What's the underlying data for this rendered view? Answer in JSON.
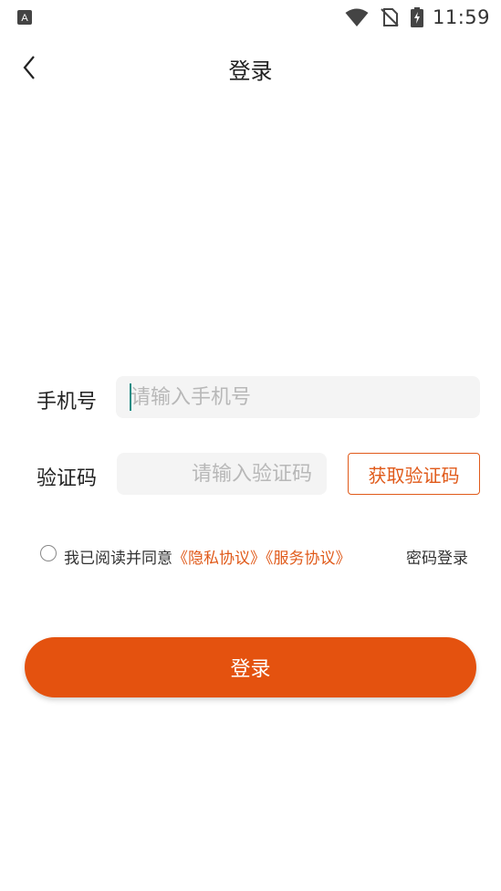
{
  "status_bar": {
    "time": "11:59",
    "left_icon": "a-badge-icon",
    "icons": [
      "wifi-icon",
      "no-sim-icon",
      "battery-charging-icon"
    ]
  },
  "header": {
    "title": "登录",
    "back_icon": "chevron-left-icon"
  },
  "form": {
    "phone": {
      "label": "手机号",
      "placeholder": "请输入手机号",
      "value": ""
    },
    "code": {
      "label": "验证码",
      "placeholder": "请输入验证码",
      "value": ""
    },
    "get_code_label": "获取验证码"
  },
  "agreement": {
    "checked": false,
    "prefix": "我已阅读并同意",
    "privacy_link": "《隐私协议》",
    "service_link": "《服务协议》",
    "password_login": "密码登录"
  },
  "login_button": "登录",
  "colors": {
    "accent": "#e4520f",
    "link": "#e05a1a",
    "caret": "#1e8c84",
    "input_bg": "#f4f4f4"
  }
}
